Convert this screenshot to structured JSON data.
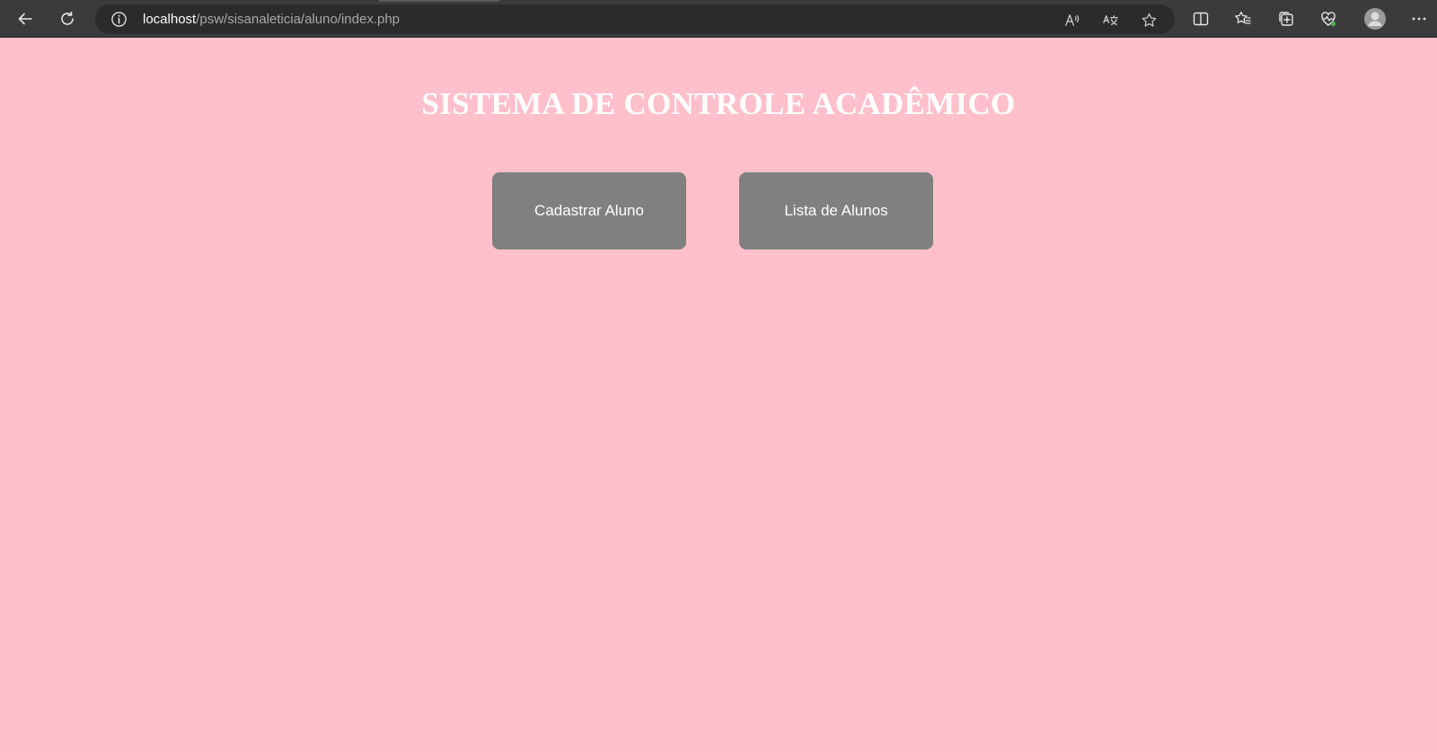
{
  "browser": {
    "url_host": "localhost",
    "url_path": "/psw/sisanaleticia/aluno/index.php",
    "icons": {
      "back": "back-arrow-icon",
      "refresh": "refresh-icon",
      "site_info": "info-icon",
      "read_aloud": "read-aloud-icon",
      "translate": "translate-icon",
      "favorite": "star-icon",
      "split_screen": "split-screen-icon",
      "favorites": "favorites-icon",
      "collections": "collections-icon",
      "browser_essentials": "heart-pulse-icon",
      "profile": "avatar-icon",
      "menu": "more-icon"
    }
  },
  "page": {
    "title": "SISTEMA DE CONTROLE ACADÊMICO",
    "buttons": {
      "register": "Cadastrar Aluno",
      "list": "Lista de Alunos"
    }
  },
  "colors": {
    "background": "#ffc0cb",
    "button": "#808080",
    "title": "#ffffff",
    "toolbar": "#3b3b3b"
  }
}
